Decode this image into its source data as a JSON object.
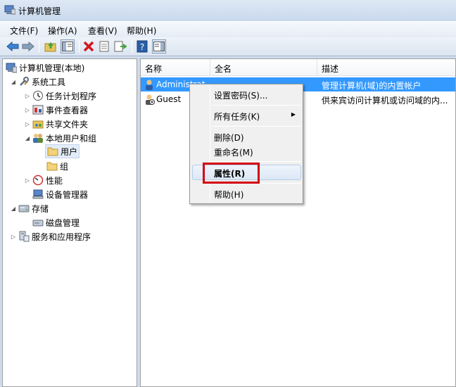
{
  "window": {
    "title": "计算机管理"
  },
  "menubar": [
    "文件(F)",
    "操作(A)",
    "查看(V)",
    "帮助(H)"
  ],
  "toolbar": {
    "icons": [
      "back-arrow-icon",
      "forward-arrow-icon",
      "up-folder-icon",
      "show-hide-tree-icon",
      "delete-icon",
      "properties-icon",
      "export-list-icon",
      "help-icon",
      "action-pane-icon"
    ]
  },
  "tree": {
    "root": "计算机管理(本地)",
    "system_tools": "系统工具",
    "task_scheduler": "任务计划程序",
    "event_viewer": "事件查看器",
    "shared_folders": "共享文件夹",
    "local_users_groups": "本地用户和组",
    "users": "用户",
    "groups": "组",
    "performance": "性能",
    "device_manager": "设备管理器",
    "storage": "存储",
    "disk_management": "磁盘管理",
    "services_apps": "服务和应用程序"
  },
  "list": {
    "columns": [
      "名称",
      "全名",
      "描述"
    ],
    "rows": [
      {
        "name": "Administrat",
        "fullname": "",
        "description": "管理计算机(域)的内置帐户"
      },
      {
        "name": "Guest",
        "fullname": "",
        "description": "供来宾访问计算机或访问域的内..."
      }
    ]
  },
  "context_menu": {
    "set_password": "设置密码(S)...",
    "all_tasks": "所有任务(K)",
    "delete": "删除(D)",
    "rename": "重命名(M)",
    "properties": "属性(R)",
    "help": "帮助(H)"
  },
  "colors": {
    "selection": "#3399ff",
    "highlight_box": "#d3000f"
  }
}
